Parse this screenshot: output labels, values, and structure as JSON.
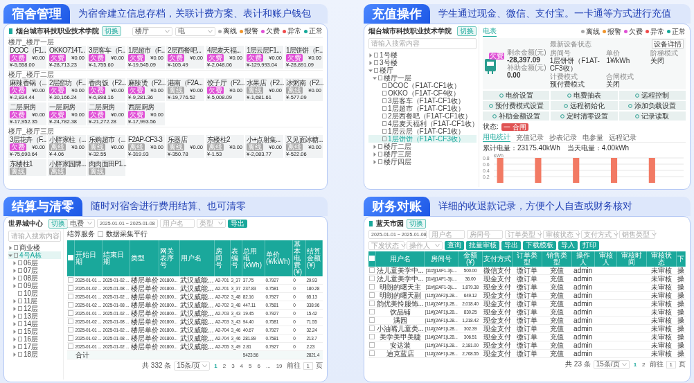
{
  "dorm_panel": {
    "title": "宿舍管理",
    "subtitle": "为宿舍建立信息存档，关联计费方案、表计和账户钱包",
    "school": "烟台城市科技职业技术学院",
    "switch_button": "切换",
    "building_select": "楼厅",
    "meter_select": "电",
    "legend": [
      {
        "label": "离线",
        "color": "#a8a8a8"
      },
      {
        "label": "报警",
        "color": "#f0962e"
      },
      {
        "label": "欠费",
        "color": "#e051d6"
      },
      {
        "label": "异常",
        "color": "#ef4b4b"
      },
      {
        "label": "正常",
        "color": "#15a99a"
      }
    ],
    "floors": [
      {
        "heading": "楼厅_楼厅一层",
        "cards": [
          {
            "name": "DCOC（F1...",
            "tag": "欠费",
            "color": "#e051d6",
            "balance": "¥-5,558.00",
            "subsidy": "¥0.00"
          },
          {
            "name": "OKKO714T...",
            "tag": "欠费",
            "color": "#e051d6",
            "balance": "¥-28,713.23",
            "subsidy": "¥0.00"
          },
          {
            "name": "3层客车（F...",
            "tag": "欠费",
            "color": "#e051d6",
            "balance": "¥-1,755.60",
            "subsidy": "¥0.00"
          },
          {
            "name": "1层超市（F...",
            "tag": "欠费",
            "color": "#e051d6",
            "balance": "¥-19,545.09",
            "subsidy": "¥0.00"
          },
          {
            "name": "2层西餐吧...",
            "tag": "欠费",
            "color": "#e051d6",
            "balance": "¥-105.49",
            "subsidy": "¥0.00"
          },
          {
            "name": "4层麦天福...",
            "tag": "欠费",
            "color": "#e051d6",
            "balance": "¥-2,048.06",
            "subsidy": "¥0.00"
          },
          {
            "name": "1层云层F1...",
            "tag": "欠费",
            "color": "#e051d6",
            "balance": "¥-129,993.04",
            "subsidy": "¥0.00"
          },
          {
            "name": "1层饼饼（F...",
            "tag": "欠费",
            "color": "#e051d6",
            "balance": "¥-28,891.09",
            "subsidy": "¥0.00"
          }
        ]
      },
      {
        "heading": "楼厅_楼厅二层",
        "cards": [
          {
            "name": "麻辣香锅（...",
            "tag": "欠费",
            "color": "#e051d6",
            "balance": "¥-2,834.44",
            "subsidy": "¥0.00"
          },
          {
            "name": "2层窑坊（F...",
            "tag": "欠费",
            "color": "#e051d6",
            "balance": "¥-30,166.24",
            "subsidy": "¥0.00"
          },
          {
            "name": "香肉饭（F2...",
            "tag": "欠费",
            "color": "#e051d6",
            "balance": "¥-6,898.16",
            "subsidy": "¥0.00"
          },
          {
            "name": "麻辣烫（F2...",
            "tag": "欠费",
            "color": "#e051d6",
            "balance": "¥-9,281.36",
            "subsidy": "¥0.00"
          },
          {
            "name": "港南（F2A...",
            "tag": "离线",
            "color": "#a8a8a8",
            "balance": "¥-19,776.52",
            "subsidy": "¥0.00"
          },
          {
            "name": "饺子厅（F2...",
            "tag": "欠费",
            "color": "#e051d6",
            "balance": "¥-5,008.09",
            "subsidy": "¥0.00"
          },
          {
            "name": "水果店（F2...",
            "tag": "离线",
            "color": "#a8a8a8",
            "balance": "¥-1,681.61",
            "subsidy": "¥0.00"
          },
          {
            "name": "冰粥南（F2...",
            "tag": "离线",
            "color": "#a8a8a8",
            "balance": "¥-577.09",
            "subsidy": "¥0.00"
          },
          {
            "name": "二层厨房",
            "tag": "欠费",
            "color": "#e051d6",
            "balance": "¥-17,952.35",
            "subsidy": "¥0.00"
          },
          {
            "name": "一层厨房",
            "tag": "欠费",
            "color": "#e051d6",
            "balance": "¥-24,782.38",
            "subsidy": "¥0.00"
          },
          {
            "name": "二层厨房",
            "tag": "欠费",
            "color": "#e051d6",
            "balance": "¥-21,272.28",
            "subsidy": "¥0.00"
          },
          {
            "name": "西层厨房",
            "tag": "欠费",
            "color": "#e051d6",
            "balance": "¥-17,993.56",
            "subsidy": "¥0.00"
          }
        ]
      },
      {
        "heading": "楼厅_楼厅三层",
        "cards": [
          {
            "name": "3层花卉（F...",
            "tag": "欠费",
            "color": "#e051d6",
            "balance": "¥-75,690.64",
            "subsidy": "¥0.00"
          },
          {
            "name": "小胖家柱（...",
            "tag": "离线",
            "color": "#a8a8a8",
            "balance": "¥-4.06",
            "subsidy": "¥0.00"
          },
          {
            "name": "乐购超市（...",
            "tag": "离线",
            "color": "#a8a8a8",
            "balance": "¥-32.55",
            "subsidy": "¥0.00"
          },
          {
            "name": "F2AP-CF3-3",
            "tag": "离线",
            "color": "#a8a8a8",
            "balance": "¥-319.93",
            "subsidy": "¥0.00"
          },
          {
            "name": "乐器店",
            "tag": "离线",
            "color": "#a8a8a8",
            "balance": "¥-350.78",
            "subsidy": "¥0.00"
          },
          {
            "name": "东楼柱2",
            "tag": "离线",
            "color": "#a8a8a8",
            "balance": "¥-1.53",
            "subsidy": "¥0.00"
          },
          {
            "name": "小+点射集...",
            "tag": "离线",
            "color": "#a8a8a8",
            "balance": "¥-2,083.77",
            "subsidy": "¥0.00"
          },
          {
            "name": "又见面冰糖...",
            "tag": "离线",
            "color": "#a8a8a8",
            "balance": "¥-522.06",
            "subsidy": "¥0.00"
          },
          {
            "name": "东楼柱1",
            "tag": "离线",
            "color": "#a8a8a8"
          },
          {
            "name": "小胖家园牌...",
            "tag": "离线",
            "color": "#a8a8a8"
          },
          {
            "name": "肉肉面田P1...",
            "tag": "离线",
            "color": "#a8a8a8"
          }
        ]
      }
    ]
  },
  "recharge_panel": {
    "title": "充值操作",
    "subtitle": "学生通过现金、微信、支付宝。一卡通等方式进行充值",
    "school": "烟台城市科技职业技术学院",
    "switch_button": "切换",
    "search": {
      "placeholder": "请输入搜索内容"
    },
    "tree": [
      {
        "label": "1号楼",
        "expanded": false,
        "selected": false
      },
      {
        "label": "3号楼",
        "expanded": false,
        "selected": false
      },
      {
        "label": "楼厅",
        "expanded": true,
        "selected": false,
        "children": [
          {
            "label": "楼厅一层",
            "expanded": true,
            "selected": false,
            "children": [
              {
                "label": "DCOC（F1AT-CF1收）",
                "selected": false
              },
              {
                "label": "OKKO（F1AT-CF4收）",
                "selected": false
              },
              {
                "label": "3层客车（F1AT-CF1收）",
                "selected": false
              },
              {
                "label": "1层超市（F1AT-CF1收）",
                "selected": false
              },
              {
                "label": "2层西餐吧（F1AT-CF1收）",
                "selected": false
              },
              {
                "label": "4层麦天福利（F1AT-CF1收）",
                "selected": false
              },
              {
                "label": "1层云层（F1AT-CF1收）",
                "selected": false
              },
              {
                "label": "1层饼饼（F1AT-CF3收）",
                "selected": true
              }
            ]
          },
          {
            "label": "楼厅二层",
            "expanded": false,
            "selected": false
          },
          {
            "label": "楼厅三层",
            "expanded": false,
            "selected": false
          },
          {
            "label": "楼厅四层",
            "expanded": false,
            "selected": false
          }
        ]
      }
    ],
    "tab": "电表",
    "legend": [
      {
        "label": "离线",
        "color": "#a8a8a8"
      },
      {
        "label": "报警",
        "color": "#f0962e"
      },
      {
        "label": "欠费",
        "color": "#e051d6"
      },
      {
        "label": "异常",
        "color": "#ef4b4b"
      },
      {
        "label": "正常",
        "color": "#15a99a"
      }
    ],
    "meter_tag": "欠费",
    "status_link": "最新设备状态",
    "details_button": "设备详情",
    "balances": [
      {
        "label": "剩余金额(元)",
        "value": "-28,397.09"
      },
      {
        "label": "补助金额(元)",
        "value": "0.00"
      }
    ],
    "fields": [
      {
        "label": "房间号",
        "value": "1层饼饼（F1AT-CF3收）"
      },
      {
        "label": "单价",
        "value": "1¥/kWh"
      },
      {
        "label": "阶梯模式",
        "value": "关闭"
      },
      {
        "label": "计费模式",
        "value": "预付费模式"
      },
      {
        "label": "合闸模式",
        "value": "关闭"
      }
    ],
    "actions": [
      "电价设置",
      "电费抽表",
      "远程控制",
      "预付费模式设置",
      "远程初始化",
      "添加负载设置",
      "补助金额设置",
      "定时清零设置",
      "记录读取"
    ],
    "state_label": "状态:",
    "state_badge": "一 合闸",
    "subtabs": [
      {
        "label": "用电统计",
        "selected": true
      },
      {
        "label": "充值记录",
        "selected": false
      },
      {
        "label": "抄表记录",
        "selected": false
      },
      {
        "label": "电参量",
        "selected": false
      },
      {
        "label": "远程记录",
        "selected": false
      }
    ],
    "stats": "累计电量：23175.40kWh　当天电量：4.00kWh",
    "chart_data": {
      "type": "bar",
      "grid": true,
      "ylabel": "kWh",
      "yticks": [
        0.2,
        0.4,
        0.6,
        0.8
      ],
      "ylim": [
        0,
        0.8
      ],
      "series": [
        {
          "color": "#f27a64",
          "values": [
            0.8,
            0,
            0,
            0.8,
            0,
            0,
            0.8,
            0,
            0,
            0.8,
            0,
            0,
            0.8,
            0,
            0
          ]
        }
      ]
    }
  },
  "settlement_panel": {
    "title": "结算与清零",
    "subtitle": "随时对宿舍进行费用结算、也可清零",
    "site": "世界城中心",
    "switch_button": "切换",
    "search": {
      "placeholder": "请输入搜索内容"
    },
    "tree": [
      {
        "label": "商业楼",
        "expanded": false,
        "selected": false
      },
      {
        "label": "4号A栋",
        "expanded": true,
        "selected": true,
        "children": [
          {
            "label": "06层",
            "expanded": false,
            "selected": false
          },
          {
            "label": "07层",
            "expanded": false,
            "selected": false
          },
          {
            "label": "08层",
            "expanded": false,
            "selected": false
          },
          {
            "label": "09层",
            "expanded": false,
            "selected": false
          },
          {
            "label": "10层",
            "selected": false
          },
          {
            "label": "11层",
            "expanded": false,
            "selected": false
          },
          {
            "label": "12层",
            "expanded": false,
            "selected": false
          },
          {
            "label": "13层",
            "expanded": false,
            "selected": false
          },
          {
            "label": "14层",
            "expanded": false,
            "selected": false
          },
          {
            "label": "15层",
            "expanded": false,
            "selected": false
          },
          {
            "label": "16层",
            "expanded": false,
            "selected": false
          },
          {
            "label": "17层",
            "expanded": false,
            "selected": false
          },
          {
            "label": "18层",
            "expanded": false,
            "selected": false
          }
        ]
      }
    ],
    "type_select": "电费",
    "date_range": "2025-01-01 ~ 2025-01-08",
    "user_field": {
      "placeholder": "用户名"
    },
    "kind_select": {
      "placeholder": "类型"
    },
    "export_button": "导出",
    "tab": "结算服务",
    "sync_checkbox": {
      "label": "数据采集平行",
      "checked": false
    },
    "select_all": {
      "checked": false
    },
    "columns": [
      "开始日期",
      "结束日期",
      "类型",
      "网关表序号",
      "用户名",
      "房间号",
      "表编号",
      "总用电(kWh)",
      "单价(¥/kWh)",
      "基本电费(¥)",
      "结算金额(¥)"
    ],
    "rows": [
      {
        "checked": false,
        "cells": [
          "2025-01-01 ...",
          "2025-01-02 ...",
          "楼层单价",
          "201800...",
          "武汉威能...",
          "A2-701",
          "3_37",
          "37.75",
          "0.7927",
          "0",
          "29.93"
        ]
      },
      {
        "checked": false,
        "cells": [
          "2025-01-02 ...",
          "2025-01-08 ...",
          "楼层单价",
          "201800...",
          "武汉威能...",
          "A2-701",
          "3_37",
          "237.83",
          "0.7581",
          "0",
          "180.28"
        ]
      },
      {
        "checked": false,
        "cells": [
          "2025-01-01 ...",
          "2025-01-02 ...",
          "楼层单价",
          "201800...",
          "武汉威能...",
          "A2-702",
          "3_48",
          "82.16",
          "0.7927",
          "0",
          "65.13"
        ]
      },
      {
        "checked": false,
        "cells": [
          "2025-01-02 ...",
          "2025-01-08 ...",
          "楼层单价",
          "201800...",
          "武汉威能...",
          "A2-702",
          "3_48",
          "447.11",
          "0.7581",
          "0",
          "338.96"
        ]
      },
      {
        "checked": false,
        "cells": [
          "2025-01-01 ...",
          "2025-01-02 ...",
          "楼层单价",
          "201800...",
          "武汉威能...",
          "A2-703",
          "3_43",
          "19.45",
          "0.7927",
          "0",
          "15.42"
        ]
      },
      {
        "checked": false,
        "cells": [
          "2025-01-02 ...",
          "2025-01-08 ...",
          "楼层单价",
          "201800...",
          "武汉威能...",
          "A2-703",
          "3_43",
          "94.40",
          "0.7581",
          "0",
          "71.55"
        ]
      },
      {
        "checked": false,
        "cells": [
          "2025-01-01 ...",
          "2025-01-02 ...",
          "楼层单价",
          "201800...",
          "武汉威能...",
          "A2-704",
          "3_46",
          "40.67",
          "0.7927",
          "0",
          "32.24"
        ]
      },
      {
        "checked": false,
        "cells": [
          "2025-01-02 ...",
          "2025-01-08 ...",
          "楼层单价",
          "201800...",
          "武汉威能...",
          "A2-704",
          "3_46",
          "281.89",
          "0.7581",
          "0",
          "213.7"
        ]
      },
      {
        "checked": false,
        "cells": [
          "2025-01-01 ...",
          "2025-01-02 ...",
          "楼层单价",
          "201800...",
          "武汉威能...",
          "A2-705",
          "3_49",
          "2.81",
          "0.7927",
          "0",
          "2.23"
        ]
      }
    ],
    "total_label": "合计",
    "total_kwh": "5423.56",
    "total_amount": "2821.4",
    "pagination": {
      "total": "共 332 条",
      "page_size": "15条/页",
      "pages": [
        {
          "label": "1",
          "selected": true
        },
        {
          "label": "2",
          "selected": false
        },
        {
          "label": "3",
          "selected": false
        },
        {
          "label": "4",
          "selected": false
        },
        {
          "label": "5",
          "selected": false
        },
        {
          "label": "6",
          "selected": false
        },
        {
          "label": "...",
          "selected": false
        },
        {
          "label": "19",
          "selected": false
        }
      ],
      "goto": "前往",
      "page": "1",
      "page_unit": "页"
    }
  },
  "finance_panel": {
    "title": "财务对账",
    "subtitle": "详细的收退款记录，方便个人自查或财务核对",
    "site": "蓝天市园",
    "switch_button": "切换",
    "date_range": "2025-01-01 ~ 2025-01-08",
    "filters": [
      {
        "placeholder": "用户名",
        "kind": "input"
      },
      {
        "placeholder": "房间号",
        "kind": "input"
      },
      {
        "placeholder": "订单类型",
        "kind": "select"
      },
      {
        "placeholder": "审核状态",
        "kind": "select"
      },
      {
        "placeholder": "支付方式",
        "kind": "select"
      },
      {
        "placeholder": "销售类型",
        "kind": "select"
      },
      {
        "placeholder": "下发状态",
        "kind": "select"
      },
      {
        "placeholder": "操作人",
        "kind": "select"
      }
    ],
    "buttons": [
      "查询",
      "批量审核",
      "导出",
      "下载模板",
      "导入",
      "打印"
    ],
    "select_all": {
      "checked": false
    },
    "columns": [
      "用户名",
      "房间号",
      "金额(¥)",
      "支付方式",
      "订单类型",
      "销售类型",
      "操作人",
      "审核人",
      "审核时间",
      "审核状态",
      "下"
    ],
    "rows": [
      {
        "checked": false,
        "cells": [
          "法儿童美学中...",
          "[11#](1AF1-3)L...",
          "500.00",
          "微信支付",
          "缴订单",
          "充值",
          "admin",
          "",
          "",
          "未审核",
          "操"
        ]
      },
      {
        "checked": false,
        "cells": [
          "法儿童美学中...",
          "[11#](1AF1-3)L...",
          "36.00",
          "现金支付",
          "缴订单",
          "充值",
          "admin",
          "",
          "",
          "未审核",
          "操"
        ]
      },
      {
        "checked": false,
        "cells": [
          "明朗的曙天主",
          "[11#](2AF1-3)L...",
          "1,879.38",
          "现金支付",
          "缴订单",
          "充值",
          "admin",
          "",
          "",
          "未审核",
          "操"
        ]
      },
      {
        "checked": false,
        "cells": [
          "明朗的曙天副",
          "[11#](2AF2)L28...",
          "649.12",
          "现金支付",
          "缴订单",
          "充值",
          "admin",
          "",
          "",
          "未审核",
          "操"
        ]
      },
      {
        "checked": false,
        "cells": [
          "韵优美怜服饰...",
          "[11#](2AF1)L28...",
          "2,018.40",
          "现金支付",
          "缴订单",
          "充值",
          "admin",
          "",
          "",
          "未审核",
          "操"
        ]
      },
      {
        "checked": false,
        "cells": [
          "饮品铺",
          "[11#](2AF1)L28...",
          "830.25",
          "现金支付",
          "缴订单",
          "充值",
          "admin",
          "",
          "",
          "未审核",
          "操"
        ]
      },
      {
        "checked": false,
        "cells": [
          "满园",
          "[11#](2AF1)L28...",
          "1,218.42",
          "现金支付",
          "缴订单",
          "充值",
          "admin",
          "",
          "",
          "未审核",
          "操"
        ]
      },
      {
        "checked": false,
        "cells": [
          "小油嘴儿童类...",
          "[11#](2AF1)L28...",
          "302.39",
          "现金支付",
          "缴订单",
          "充值",
          "admin",
          "",
          "",
          "未审核",
          "操"
        ]
      },
      {
        "checked": false,
        "cells": [
          "美学美甲美睫",
          "[11#](2AF1)L28...",
          "306.51",
          "现金支付",
          "缴订单",
          "充值",
          "admin",
          "",
          "",
          "未审核",
          "操"
        ]
      },
      {
        "checked": false,
        "cells": [
          "安达装",
          "[11#](2AF1)L28...",
          "2,181.00",
          "现金支付",
          "缴订单",
          "充值",
          "admin",
          "",
          "",
          "未审核",
          "操"
        ]
      },
      {
        "checked": false,
        "cells": [
          "迪克蓝店",
          "[11#](2AF1)L28...",
          "2,768.55",
          "现金支付",
          "缴订单",
          "充值",
          "admin",
          "",
          "",
          "未审核",
          "操"
        ]
      }
    ],
    "pagination": {
      "total": "共 23 条",
      "page_size": "15条/页",
      "pages": [
        {
          "label": "1",
          "selected": true
        },
        {
          "label": "2",
          "selected": false
        }
      ],
      "goto": "前往",
      "page": "1",
      "page_unit": "页"
    }
  }
}
